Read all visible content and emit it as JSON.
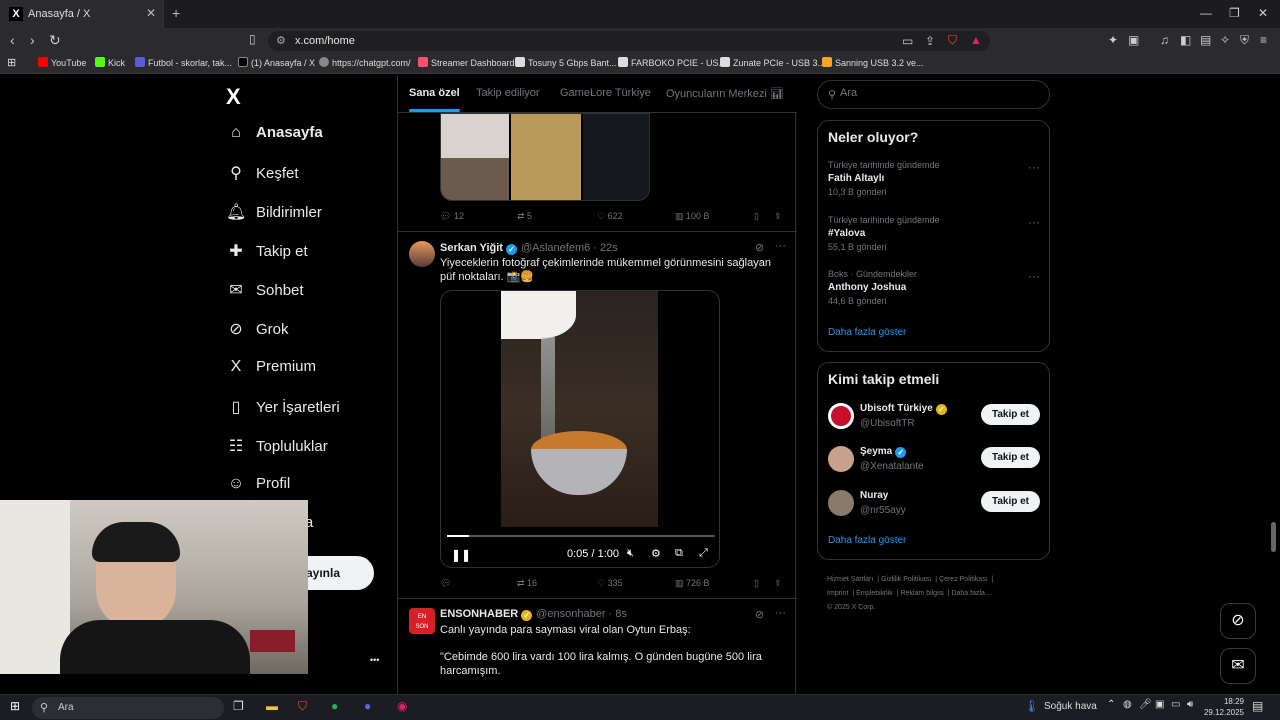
{
  "browser": {
    "tab_title": "Anasayfa / X",
    "tab_close": "✕",
    "new_tab": "+",
    "url": "x.com/home",
    "bookmarks": [
      {
        "label": "YouTube",
        "color": "#ff0000"
      },
      {
        "label": "Kick",
        "color": "#53fc18"
      },
      {
        "label": "Futbol - skorlar, tak...",
        "color": "#5b5bd6"
      },
      {
        "label": "(1) Anasayfa / X",
        "color": "#000000"
      },
      {
        "label": "https://chatgpt.com/",
        "color": "#888888"
      },
      {
        "label": "Streamer Dashboard",
        "color": "#ff4f6d"
      },
      {
        "label": "Tosuny 5 Gbps Bant...",
        "color": "#dddddd"
      },
      {
        "label": "FARBOKO PCIE - US...",
        "color": "#dddddd"
      },
      {
        "label": "Zunate PCIe - USB 3...",
        "color": "#dddddd"
      },
      {
        "label": "Sanning USB 3.2 ve...",
        "color": "#f5a623"
      }
    ]
  },
  "sidebar": {
    "logo": "X",
    "items": [
      {
        "label": "Anasayfa",
        "icon": "home-icon",
        "glyph": "⌂"
      },
      {
        "label": "Keşfet",
        "icon": "search-icon",
        "glyph": "⚲"
      },
      {
        "label": "Bildirimler",
        "icon": "bell-icon",
        "glyph": "♫"
      },
      {
        "label": "Takip et",
        "icon": "follow-icon",
        "glyph": "✚"
      },
      {
        "label": "Sohbet",
        "icon": "mail-icon",
        "glyph": "✉"
      },
      {
        "label": "Grok",
        "icon": "grok-icon",
        "glyph": "⊘"
      },
      {
        "label": "Premium",
        "icon": "x-premium-icon",
        "glyph": "X"
      },
      {
        "label": "Yer İşaretleri",
        "icon": "bookmark-icon",
        "glyph": "▯"
      },
      {
        "label": "Topluluklar",
        "icon": "communities-icon",
        "glyph": "☷"
      },
      {
        "label": "Profil",
        "icon": "profile-icon",
        "glyph": "☺"
      }
    ],
    "more_partial": "zla",
    "post_partial": "ayınla",
    "more_dots": "•••"
  },
  "feed": {
    "tabs": [
      "Sana özel",
      "Takip ediliyor",
      "GameLore Türkiye",
      "Oyuncuların Merkezi"
    ],
    "prev_actions": {
      "replies": "12",
      "reposts": "5",
      "likes": "622",
      "views": "100 B"
    },
    "tweet1": {
      "name": "Serkan Yiğit",
      "handle": "@Aslanefem6 · 22s",
      "text": "Yiyeceklerin fotoğraf çekimlerinde mükemmel görünmesini sağlayan püf noktaları. 📸🍔",
      "video_time": "0:05 / 1:00",
      "video_progress": 0.083,
      "actions": {
        "replies": "",
        "reposts": "16",
        "likes": "335",
        "views": "726 B"
      }
    },
    "tweet2": {
      "name": "ENSONHABER",
      "handle": "@ensonhaber · 8s",
      "line1": "Canlı yayında para sayması viral olan Oytun Erbaş:",
      "line2": "\"Cebimde 600 lira vardı 100 lira kalmış. O günden bugüne 500 lira harcamışım."
    }
  },
  "right": {
    "search_placeholder": "Ara",
    "trends_title": "Neler oluyor?",
    "trends": [
      {
        "context": "Türkiye tarihinde gündemde",
        "topic": "Fatih Altaylı",
        "count": "10,3 B gönderi"
      },
      {
        "context": "Türkiye tarihinde gündemde",
        "topic": "#Yalova",
        "count": "55,1 B gönderi"
      },
      {
        "context": "Boks · Gündemdekiler",
        "topic": "Anthony Joshua",
        "count": "44,6 B gönderi"
      }
    ],
    "show_more": "Daha fazla göster",
    "follow_title": "Kimi takip etmeli",
    "follows": [
      {
        "name": "Ubisoft Türkiye",
        "handle": "@UbisoftTR",
        "badge": "gold",
        "avatar_color": "#c8102e"
      },
      {
        "name": "Şeyma",
        "handle": "@Xenatalante",
        "badge": "blue",
        "avatar_color": "#c9a08a"
      },
      {
        "name": "Nuray",
        "handle": "@nr55ayy",
        "badge": "",
        "avatar_color": "#8a7a6a"
      }
    ],
    "follow_button": "Takip et",
    "footer": [
      "Hizmet Şartları",
      "Gizlilik Politikası",
      "Çerez Politikası",
      "Imprint",
      "Erişilebilirlik",
      "Reklam bilgisi",
      "Daha fazla ...",
      "© 2025 X Corp."
    ]
  },
  "taskbar": {
    "search_placeholder": "Ara",
    "weather": "Soğuk hava",
    "time": "18:29",
    "date": "29.12.2025"
  }
}
